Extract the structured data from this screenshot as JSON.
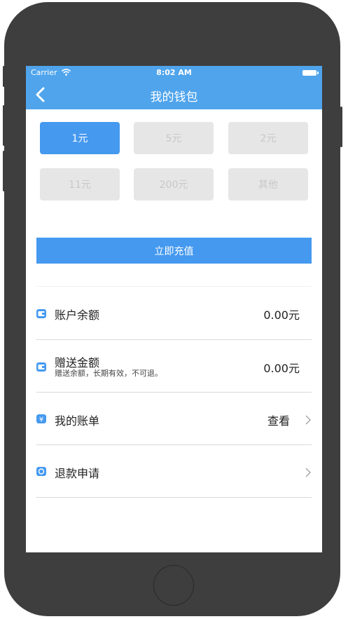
{
  "status_bar": {
    "carrier": "Carrier",
    "time": "8:02 AM"
  },
  "nav": {
    "title": "我的钱包"
  },
  "amounts": {
    "row1": [
      "1元",
      "5元",
      "2元"
    ],
    "row2": [
      "11元",
      "200元",
      "其他"
    ],
    "selected": "1元"
  },
  "recharge_button": "立即充值",
  "rows": {
    "balance": {
      "label": "账户余额",
      "value": "0.00元"
    },
    "gift": {
      "label": "赠送金额",
      "sub": "赠送余额，长期有效，不可退。",
      "value": "0.00元"
    },
    "bill": {
      "label": "我的账单",
      "link": "查看"
    },
    "refund": {
      "label": "退款申请"
    }
  },
  "colors": {
    "accent": "#4599ef",
    "nav": "#4fa4ec",
    "device": "#3e3e3e"
  },
  "icons": [
    "back-icon",
    "wifi-icon",
    "battery-icon",
    "wallet-icon",
    "gift-wallet-icon",
    "yen-icon",
    "refund-icon",
    "chevron-right-icon"
  ]
}
